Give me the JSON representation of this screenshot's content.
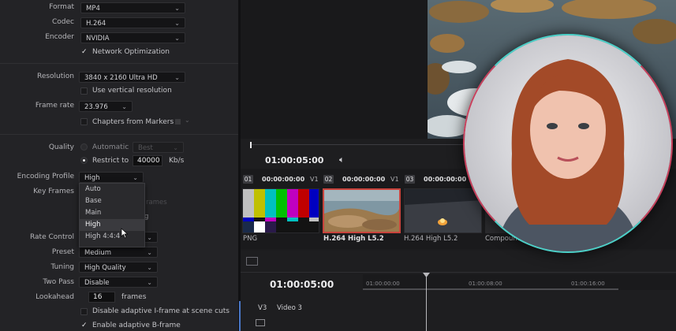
{
  "render": {
    "format_label": "Format",
    "format_value": "MP4",
    "codec_label": "Codec",
    "codec_value": "H.264",
    "encoder_label": "Encoder",
    "encoder_value": "NVIDIA",
    "network_opt_label": "Network Optimization",
    "resolution_label": "Resolution",
    "resolution_value": "3840 x 2160 Ultra HD",
    "vertical_res_label": "Use vertical resolution",
    "framerate_label": "Frame rate",
    "framerate_value": "23.976",
    "chapters_label": "Chapters from Markers",
    "quality_label": "Quality",
    "auto_label": "Automatic",
    "best_value": "Best",
    "restrict_label": "Restrict to",
    "restrict_value": "40000",
    "kbs_label": "Kb/s",
    "enc_profile_label": "Encoding Profile",
    "enc_profile_value": "High",
    "key_frames_label": "Key Frames",
    "profile_options": [
      "Auto",
      "Base",
      "Main",
      "High",
      "High 4:4:4"
    ],
    "rate_control_label": "Rate Control",
    "preset_label": "Preset",
    "preset_value": "Medium",
    "tuning_label": "Tuning",
    "tuning_value": "High Quality",
    "two_pass_label": "Two Pass",
    "two_pass_value": "Disable",
    "lookahead_label": "Lookahead",
    "lookahead_value": "16",
    "frames_label": "frames",
    "disable_iframe_label": "Disable adaptive I-frame at scene cuts",
    "enable_bframe_label": "Enable adaptive B-frame"
  },
  "player": {
    "timecode": "01:00:05:00"
  },
  "clips": [
    {
      "num": "01",
      "tc": "00:00:00:00",
      "track": "V1",
      "name": "PNG"
    },
    {
      "num": "02",
      "tc": "00:00:00:00",
      "track": "V1",
      "name": "H.264 High L5.2"
    },
    {
      "num": "03",
      "tc": "00:00:00:00",
      "track": "",
      "name": "H.264 High L5.2"
    },
    {
      "num": "",
      "tc": "",
      "track": "",
      "name": "Compound C"
    }
  ],
  "timeline": {
    "timecode": "01:00:05:00",
    "ruler": [
      "01:00:00:00",
      "01:00:08:00",
      "01:00:16:00"
    ],
    "track_id": "V3",
    "track_name": "Video 3"
  },
  "colors": {
    "accent_red": "#c8433c",
    "bars": [
      "#c0c0c0",
      "#c0c000",
      "#00c0c0",
      "#00c000",
      "#c000c0",
      "#c00000",
      "#0000c0"
    ]
  }
}
